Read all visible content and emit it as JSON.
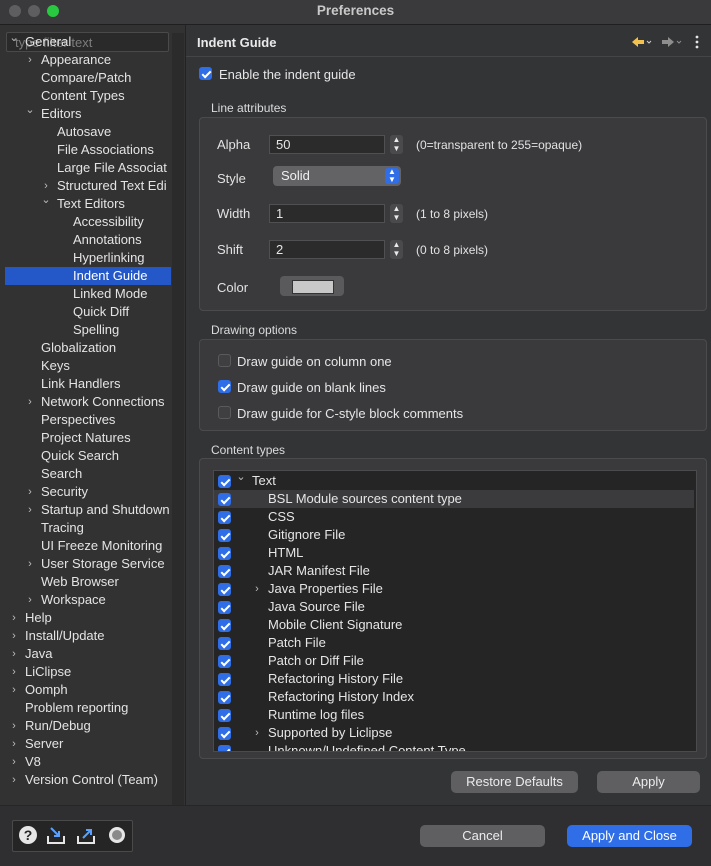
{
  "window": {
    "title": "Preferences"
  },
  "filter": {
    "placeholder": "type filter text"
  },
  "tree": [
    {
      "label": "General",
      "level": 0,
      "twisty": "open"
    },
    {
      "label": "Appearance",
      "level": 1,
      "twisty": "closed"
    },
    {
      "label": "Compare/Patch",
      "level": 1,
      "twisty": ""
    },
    {
      "label": "Content Types",
      "level": 1,
      "twisty": ""
    },
    {
      "label": "Editors",
      "level": 1,
      "twisty": "open"
    },
    {
      "label": "Autosave",
      "level": 2,
      "twisty": ""
    },
    {
      "label": "File Associations",
      "level": 2,
      "twisty": ""
    },
    {
      "label": "Large File Associat",
      "level": 2,
      "twisty": ""
    },
    {
      "label": "Structured Text Edi",
      "level": 2,
      "twisty": "closed"
    },
    {
      "label": "Text Editors",
      "level": 2,
      "twisty": "open"
    },
    {
      "label": "Accessibility",
      "level": 3,
      "twisty": ""
    },
    {
      "label": "Annotations",
      "level": 3,
      "twisty": ""
    },
    {
      "label": "Hyperlinking",
      "level": 3,
      "twisty": ""
    },
    {
      "label": "Indent Guide",
      "level": 3,
      "twisty": "",
      "selected": true
    },
    {
      "label": "Linked Mode",
      "level": 3,
      "twisty": ""
    },
    {
      "label": "Quick Diff",
      "level": 3,
      "twisty": ""
    },
    {
      "label": "Spelling",
      "level": 3,
      "twisty": ""
    },
    {
      "label": "Globalization",
      "level": 1,
      "twisty": ""
    },
    {
      "label": "Keys",
      "level": 1,
      "twisty": ""
    },
    {
      "label": "Link Handlers",
      "level": 1,
      "twisty": ""
    },
    {
      "label": "Network Connections",
      "level": 1,
      "twisty": "closed"
    },
    {
      "label": "Perspectives",
      "level": 1,
      "twisty": ""
    },
    {
      "label": "Project Natures",
      "level": 1,
      "twisty": ""
    },
    {
      "label": "Quick Search",
      "level": 1,
      "twisty": ""
    },
    {
      "label": "Search",
      "level": 1,
      "twisty": ""
    },
    {
      "label": "Security",
      "level": 1,
      "twisty": "closed"
    },
    {
      "label": "Startup and Shutdown",
      "level": 1,
      "twisty": "closed"
    },
    {
      "label": "Tracing",
      "level": 1,
      "twisty": ""
    },
    {
      "label": "UI Freeze Monitoring",
      "level": 1,
      "twisty": ""
    },
    {
      "label": "User Storage Service",
      "level": 1,
      "twisty": "closed"
    },
    {
      "label": "Web Browser",
      "level": 1,
      "twisty": ""
    },
    {
      "label": "Workspace",
      "level": 1,
      "twisty": "closed"
    },
    {
      "label": "Help",
      "level": 0,
      "twisty": "closed"
    },
    {
      "label": "Install/Update",
      "level": 0,
      "twisty": "closed"
    },
    {
      "label": "Java",
      "level": 0,
      "twisty": "closed"
    },
    {
      "label": "LiClipse",
      "level": 0,
      "twisty": "closed"
    },
    {
      "label": "Oomph",
      "level": 0,
      "twisty": "closed"
    },
    {
      "label": "Problem reporting",
      "level": 0,
      "twisty": ""
    },
    {
      "label": "Run/Debug",
      "level": 0,
      "twisty": "closed"
    },
    {
      "label": "Server",
      "level": 0,
      "twisty": "closed"
    },
    {
      "label": "V8",
      "level": 0,
      "twisty": "closed"
    },
    {
      "label": "Version Control (Team)",
      "level": 0,
      "twisty": "closed"
    }
  ],
  "page": {
    "title": "Indent Guide",
    "enable_label": "Enable the indent guide",
    "enable_checked": true
  },
  "line_attributes": {
    "label": "Line attributes",
    "alpha_label": "Alpha",
    "alpha_value": "50",
    "alpha_hint": "(0=transparent to 255=opaque)",
    "style_label": "Style",
    "style_value": "Solid",
    "width_label": "Width",
    "width_value": "1",
    "width_hint": "(1 to 8 pixels)",
    "shift_label": "Shift",
    "shift_value": "2",
    "shift_hint": "(0 to 8 pixels)",
    "color_label": "Color",
    "color_value": "#c8c8c8"
  },
  "drawing_options": {
    "label": "Drawing options",
    "items": [
      {
        "label": "Draw guide on column one",
        "checked": false
      },
      {
        "label": "Draw guide on blank lines",
        "checked": true
      },
      {
        "label": "Draw guide for C-style block comments",
        "checked": false
      }
    ]
  },
  "content_types": {
    "label": "Content types",
    "items": [
      {
        "label": "Text",
        "level": 0,
        "twisty": "open",
        "checked": true
      },
      {
        "label": "BSL Module sources content type",
        "level": 1,
        "twisty": "",
        "checked": true,
        "highlight": true
      },
      {
        "label": "CSS",
        "level": 1,
        "twisty": "",
        "checked": true
      },
      {
        "label": "Gitignore File",
        "level": 1,
        "twisty": "",
        "checked": true
      },
      {
        "label": "HTML",
        "level": 1,
        "twisty": "",
        "checked": true
      },
      {
        "label": "JAR Manifest File",
        "level": 1,
        "twisty": "",
        "checked": true
      },
      {
        "label": "Java Properties File",
        "level": 1,
        "twisty": "closed",
        "checked": true
      },
      {
        "label": "Java Source File",
        "level": 1,
        "twisty": "",
        "checked": true
      },
      {
        "label": "Mobile Client Signature",
        "level": 1,
        "twisty": "",
        "checked": true
      },
      {
        "label": "Patch File",
        "level": 1,
        "twisty": "",
        "checked": true
      },
      {
        "label": "Patch or Diff File",
        "level": 1,
        "twisty": "",
        "checked": true
      },
      {
        "label": "Refactoring History File",
        "level": 1,
        "twisty": "",
        "checked": true
      },
      {
        "label": "Refactoring History Index",
        "level": 1,
        "twisty": "",
        "checked": true
      },
      {
        "label": "Runtime log files",
        "level": 1,
        "twisty": "",
        "checked": true
      },
      {
        "label": "Supported by Liclipse",
        "level": 1,
        "twisty": "closed",
        "checked": true
      },
      {
        "label": "Unknown/Undefined Content Type",
        "level": 1,
        "twisty": "",
        "checked": true
      }
    ]
  },
  "buttons": {
    "restore_defaults": "Restore Defaults",
    "apply": "Apply",
    "cancel": "Cancel",
    "apply_and_close": "Apply and Close"
  },
  "footer_icons": [
    "help-icon",
    "import-icon",
    "export-icon",
    "record-icon"
  ],
  "colors": {
    "accent": "#2f6ee6",
    "selection": "#2458c8"
  }
}
